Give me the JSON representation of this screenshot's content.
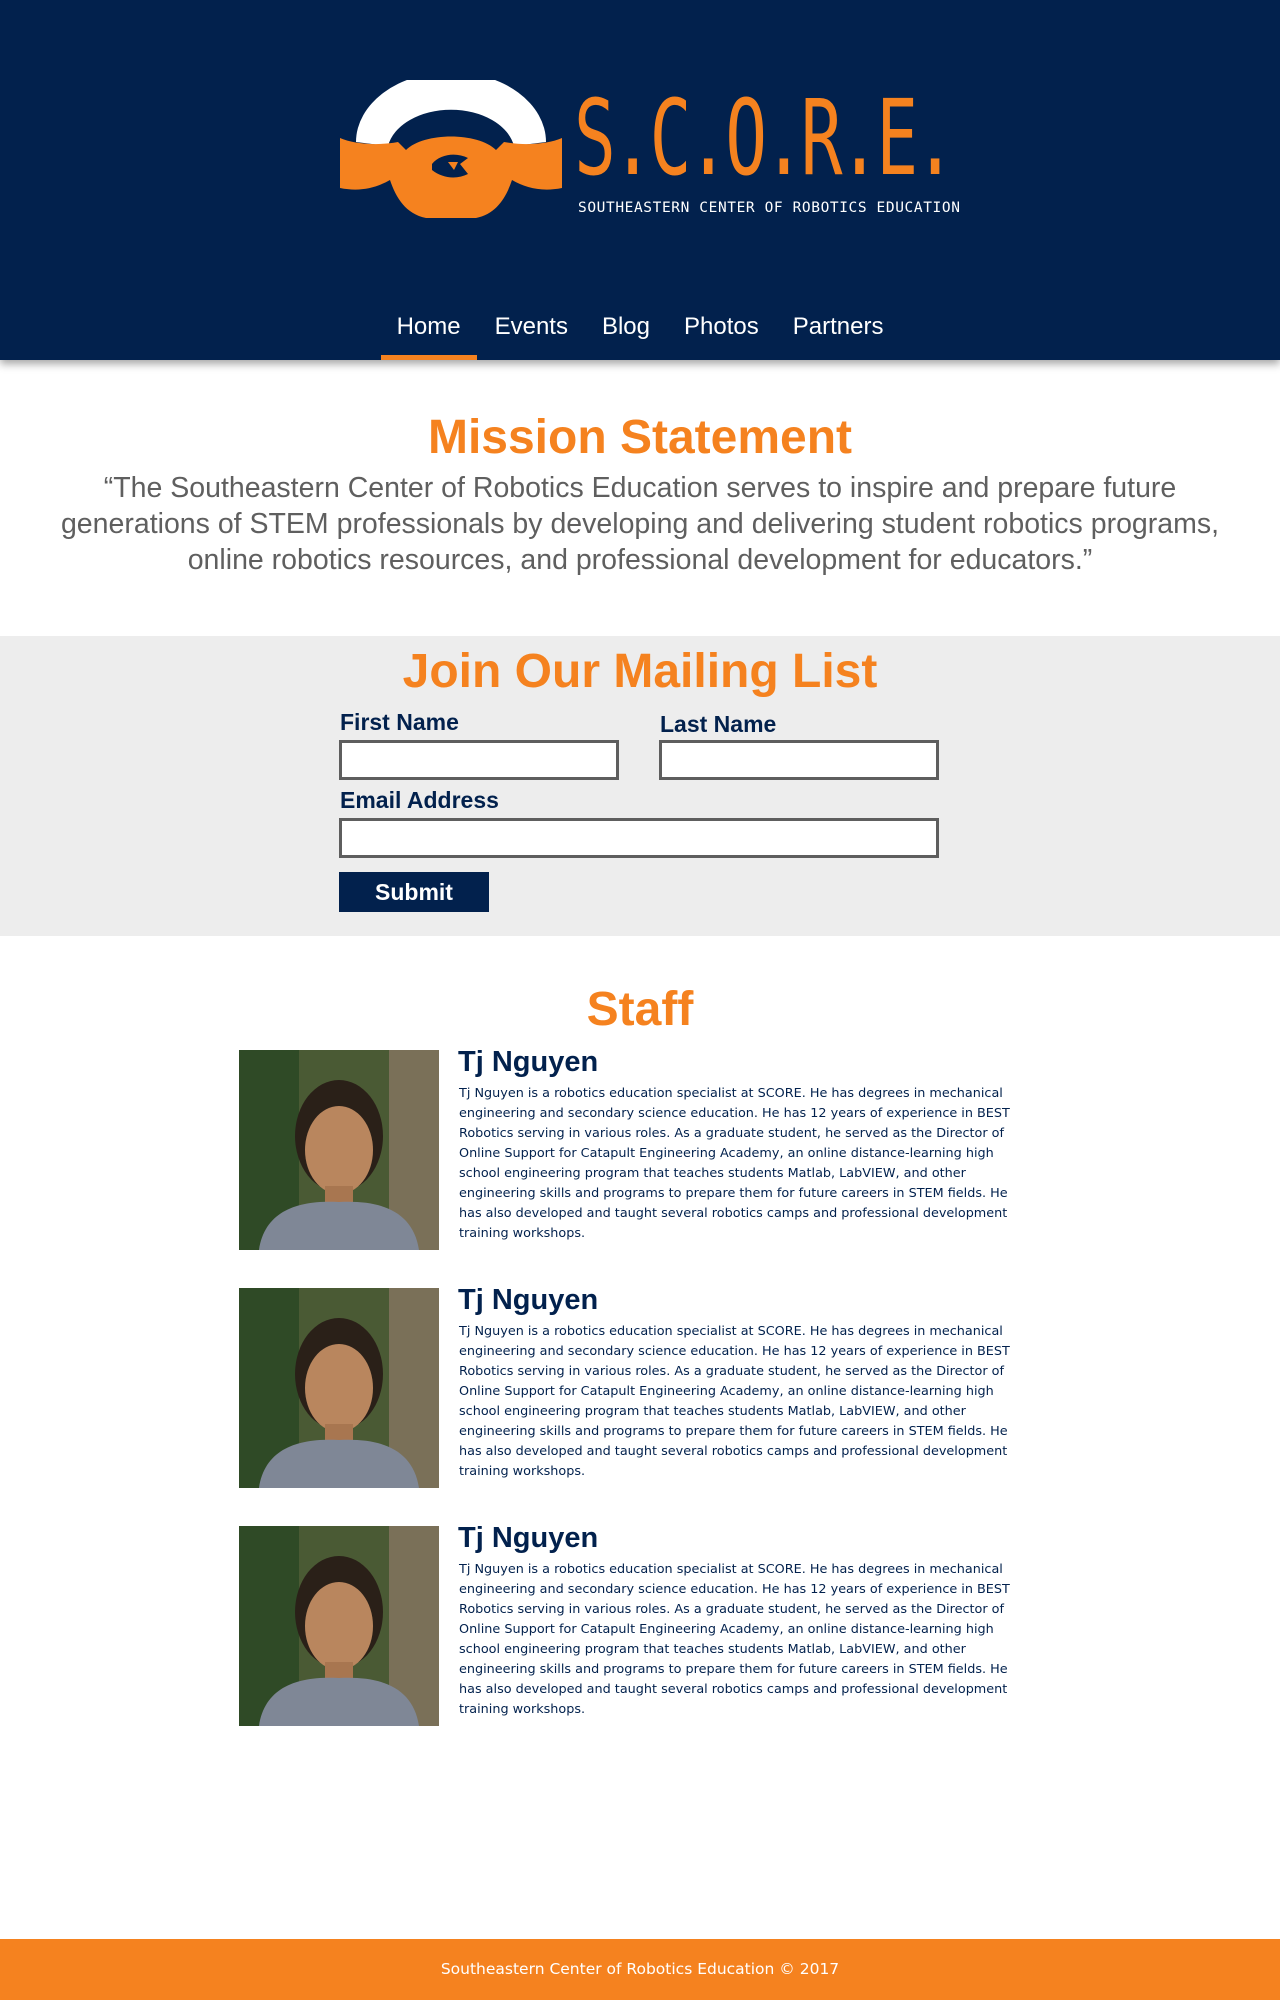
{
  "brand": {
    "logo_title": "S.C.O.R.E.",
    "logo_subtitle": "SOUTHEASTERN CENTER OF ROBOTICS EDUCATION",
    "primary_color": "#02214d",
    "accent_color": "#f5821f"
  },
  "nav": {
    "items": [
      {
        "label": "Home",
        "active": true
      },
      {
        "label": "Events",
        "active": false
      },
      {
        "label": "Blog",
        "active": false
      },
      {
        "label": "Photos",
        "active": false
      },
      {
        "label": "Partners",
        "active": false
      }
    ]
  },
  "mission": {
    "title": "Mission Statement",
    "text": "“The Southeastern Center of Robotics Education serves to inspire and prepare future generations of STEM professionals by developing and delivering student robotics programs, online robotics resources, and professional development for educators.”"
  },
  "mailing": {
    "title": "Join Our Mailing List",
    "first_name_label": "First Name",
    "first_name_value": "",
    "last_name_label": "Last Name",
    "last_name_value": "",
    "email_label": "Email Address",
    "email_value": "",
    "submit_label": "Submit"
  },
  "staff": {
    "title": "Staff",
    "members": [
      {
        "name": "Tj Nguyen",
        "bio": "Tj Nguyen is a robotics education specialist at SCORE. He has degrees in mechanical engineering and secondary science education. He has 12 years of experience in BEST Robotics serving in various roles. As a graduate student, he served as the Director of Online Support for Catapult Engineering Academy, an online distance-learning high school engineering program that teaches students Matlab, LabVIEW, and other engineering skills and programs to prepare them for future careers in STEM fields. He has also developed and taught several robotics camps and professional development training workshops."
      },
      {
        "name": "Tj Nguyen",
        "bio": "Tj Nguyen is a robotics education specialist at SCORE. He has degrees in mechanical engineering and secondary science education. He has 12 years of experience in BEST Robotics serving in various roles. As a graduate student, he served as the Director of Online Support for Catapult Engineering Academy, an online distance-learning high school engineering program that teaches students Matlab, LabVIEW, and other engineering skills and programs to prepare them for future careers in STEM fields. He has also developed and taught several robotics camps and professional development training workshops."
      },
      {
        "name": "Tj Nguyen",
        "bio": "Tj Nguyen is a robotics education specialist at SCORE. He has degrees in mechanical engineering and secondary science education. He has 12 years of experience in BEST Robotics serving in various roles. As a graduate student, he served as the Director of Online Support for Catapult Engineering Academy, an online distance-learning high school engineering program that teaches students Matlab, LabVIEW, and other engineering skills and programs to prepare them for future careers in STEM fields. He has also developed and taught several robotics camps and professional development training workshops."
      }
    ]
  },
  "footer": {
    "text": "Southeastern Center of Robotics Education © 2017"
  }
}
